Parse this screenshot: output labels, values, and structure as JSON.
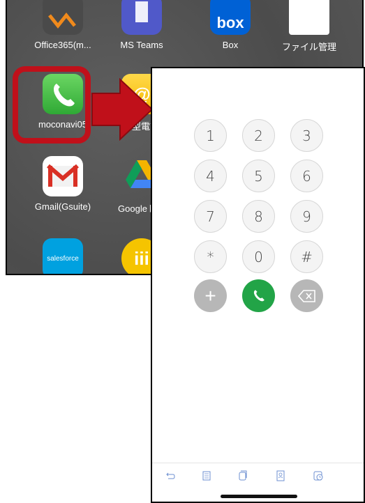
{
  "home_screen": {
    "apps": [
      {
        "label": "Office365(m...",
        "icon": "office365-icon"
      },
      {
        "label": "MS Teams",
        "icon": "teams-icon"
      },
      {
        "label": "Box",
        "icon": "box-icon",
        "icon_text": "box"
      },
      {
        "label": "ファイル管理",
        "icon": "file-manager-icon"
      },
      {
        "label": "moconavi05",
        "icon": "phone-app-icon"
      },
      {
        "label": "型電話",
        "icon": "mail-app-icon",
        "icon_text": "@"
      },
      {
        "label": "Gmail(Gsuite)",
        "icon": "gmail-icon"
      },
      {
        "label": "Googleドラ",
        "icon": "google-drive-icon"
      },
      {
        "label": "",
        "icon": "salesforce-icon",
        "icon_text": "salesforce"
      },
      {
        "label": "",
        "icon": "yellow-app-icon",
        "icon_text": "iii"
      }
    ],
    "highlight_color": "#c0101a"
  },
  "dialer": {
    "keys": [
      "1",
      "2",
      "3",
      "4",
      "5",
      "6",
      "7",
      "8",
      "9",
      "*",
      "0",
      "#"
    ],
    "add_label": "+",
    "call_color": "#22a447",
    "tabs": [
      "redial-icon",
      "log-icon",
      "copy-icon",
      "contacts-icon",
      "history-icon"
    ]
  }
}
